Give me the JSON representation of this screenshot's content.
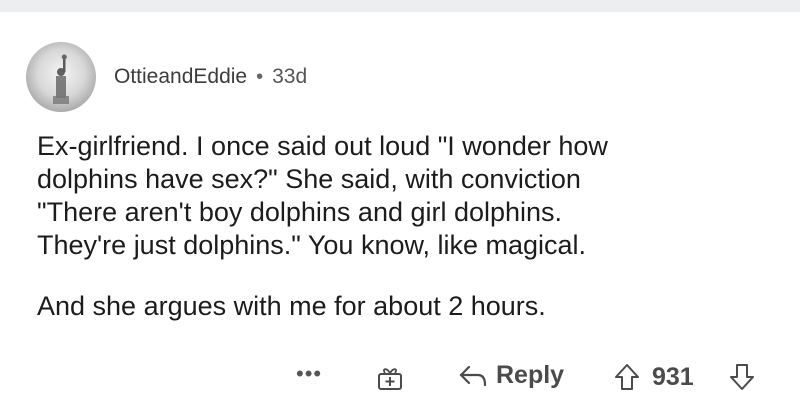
{
  "comment": {
    "username": "OttieandEddie",
    "separator": "•",
    "age": "33d",
    "paragraphs": [
      "Ex-girlfriend.  I once said out loud \"I wonder how\ndolphins have sex?\"  She said, with conviction\n\"There aren't boy dolphins and girl dolphins.\nThey're just dolphins.\"  You know, like magical.",
      "And she argues with me for about 2 hours."
    ]
  },
  "actions": {
    "more_label": "•••",
    "reply_label": "Reply",
    "score": "931",
    "icons": [
      "more-icon",
      "award-gift-icon",
      "reply-arrow-icon",
      "upvote-arrow-icon",
      "downvote-arrow-icon"
    ]
  },
  "colors": {
    "top_strip": "#eceeef",
    "text": "#1c1c1c",
    "muted": "#4b4b4b"
  }
}
